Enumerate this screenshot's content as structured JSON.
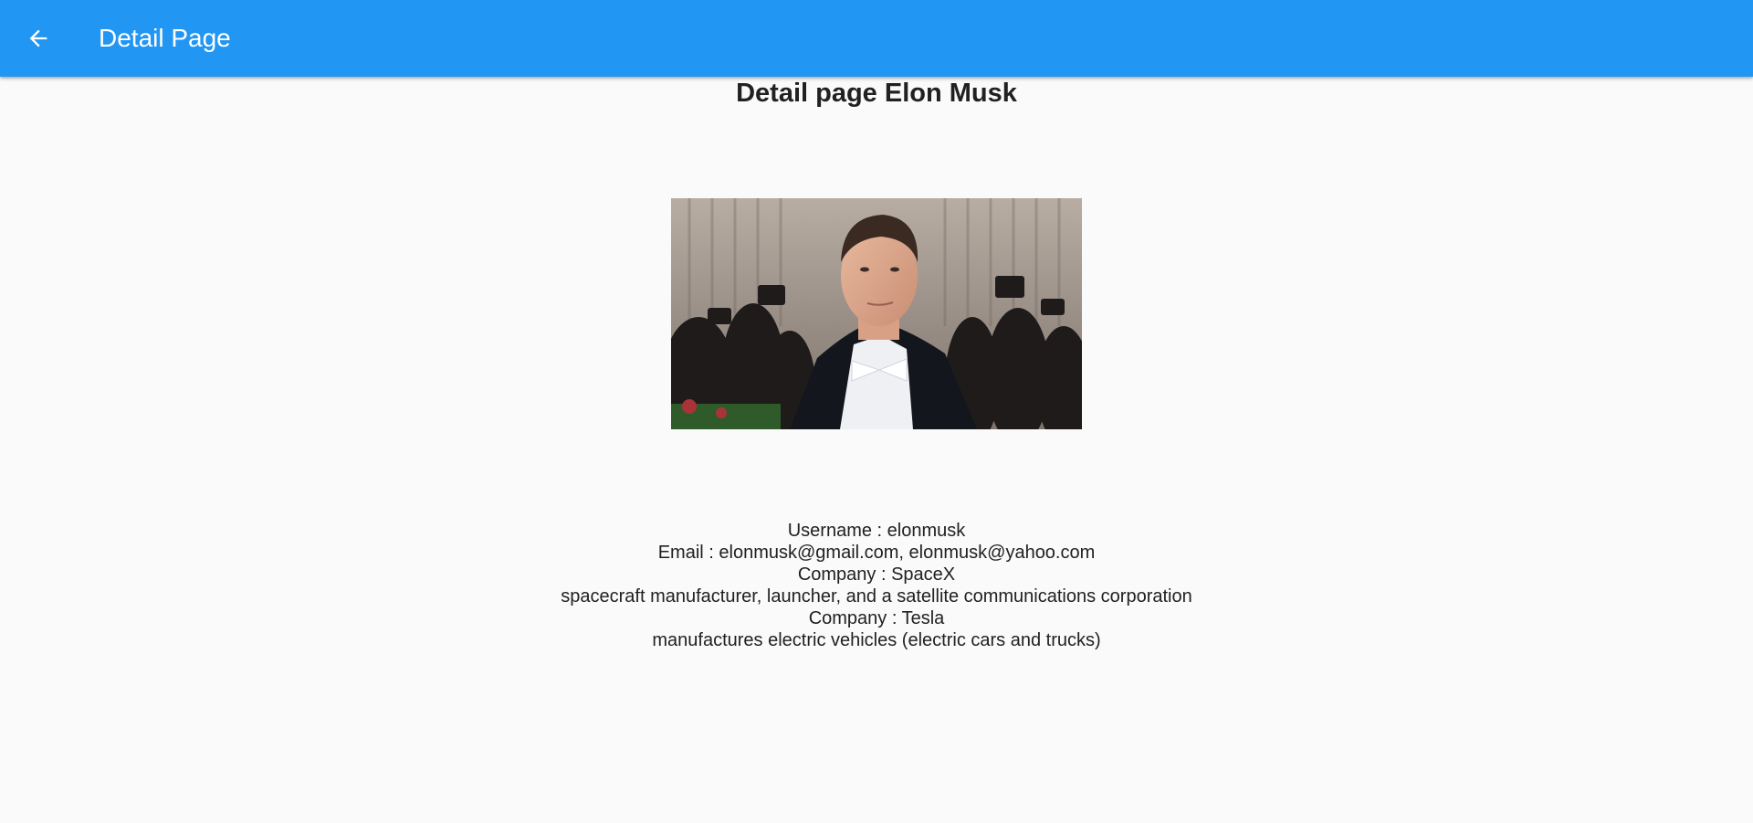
{
  "app_bar": {
    "title": "Detail Page",
    "back_icon": "arrow-back-icon",
    "background_color": "#2196f3"
  },
  "page": {
    "heading": "Detail page Elon Musk",
    "photo_subject": "portrait photo of a man in a black tuxedo and white bow tie with photographers in background"
  },
  "details": {
    "username": "Username : elonmusk",
    "email": "Email : elonmusk@gmail.com, elonmusk@yahoo.com",
    "company_1": "Company : SpaceX",
    "company_1_description": "spacecraft manufacturer, launcher, and a satellite communications corporation",
    "company_2": "Company : Tesla",
    "company_2_description": "manufactures electric vehicles (electric cars and trucks)"
  }
}
